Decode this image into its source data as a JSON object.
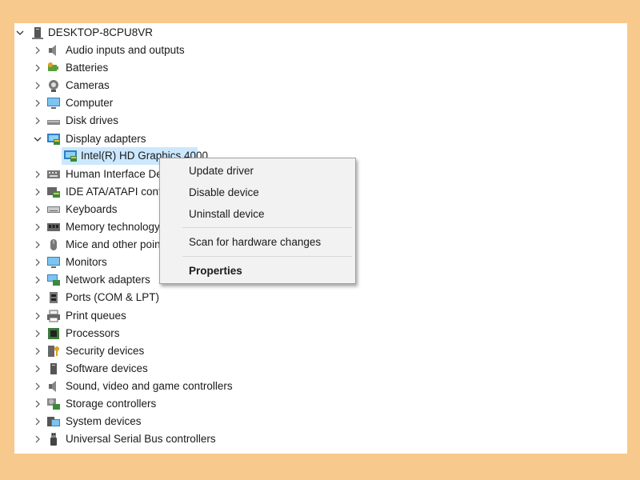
{
  "tree": {
    "root": {
      "label": "DESKTOP-8CPU8VR",
      "icon": "computer-tower-icon"
    },
    "categories": [
      {
        "label": "Audio inputs and outputs",
        "icon": "speaker-icon"
      },
      {
        "label": "Batteries",
        "icon": "battery-icon"
      },
      {
        "label": "Cameras",
        "icon": "camera-icon"
      },
      {
        "label": "Computer",
        "icon": "monitor-icon"
      },
      {
        "label": "Disk drives",
        "icon": "disk-drive-icon"
      },
      {
        "label": "Display adapters",
        "icon": "display-adapter-icon",
        "expanded": true
      },
      {
        "label": "Human Interface Dev",
        "icon": "hid-icon"
      },
      {
        "label": "IDE ATA/ATAPI contro",
        "icon": "ide-controller-icon"
      },
      {
        "label": "Keyboards",
        "icon": "keyboard-icon"
      },
      {
        "label": "Memory technology",
        "icon": "memory-chip-icon"
      },
      {
        "label": "Mice and other point",
        "icon": "mouse-icon"
      },
      {
        "label": "Monitors",
        "icon": "monitor-icon"
      },
      {
        "label": "Network adapters",
        "icon": "network-adapter-icon"
      },
      {
        "label": "Ports (COM & LPT)",
        "icon": "port-icon"
      },
      {
        "label": "Print queues",
        "icon": "printer-icon"
      },
      {
        "label": "Processors",
        "icon": "processor-icon"
      },
      {
        "label": "Security devices",
        "icon": "security-key-icon"
      },
      {
        "label": "Software devices",
        "icon": "software-device-icon"
      },
      {
        "label": "Sound, video and game controllers",
        "icon": "speaker-icon"
      },
      {
        "label": "Storage controllers",
        "icon": "storage-controller-icon"
      },
      {
        "label": "System devices",
        "icon": "system-device-icon"
      },
      {
        "label": "Universal Serial Bus controllers",
        "icon": "usb-icon"
      }
    ],
    "child": {
      "label": "Intel(R) HD Graphics 4000",
      "icon": "display-adapter-icon",
      "selected": true
    }
  },
  "context_menu": {
    "items": [
      {
        "label": "Update driver",
        "bold": false
      },
      {
        "label": "Disable device",
        "bold": false
      },
      {
        "label": "Uninstall device",
        "bold": false
      },
      {
        "label": "Scan for hardware changes",
        "bold": false
      },
      {
        "label": "Properties",
        "bold": true
      }
    ]
  },
  "colors": {
    "background": "#f8c98c",
    "selection": "#cce8ff",
    "menu_bg": "#f2f2f2"
  }
}
